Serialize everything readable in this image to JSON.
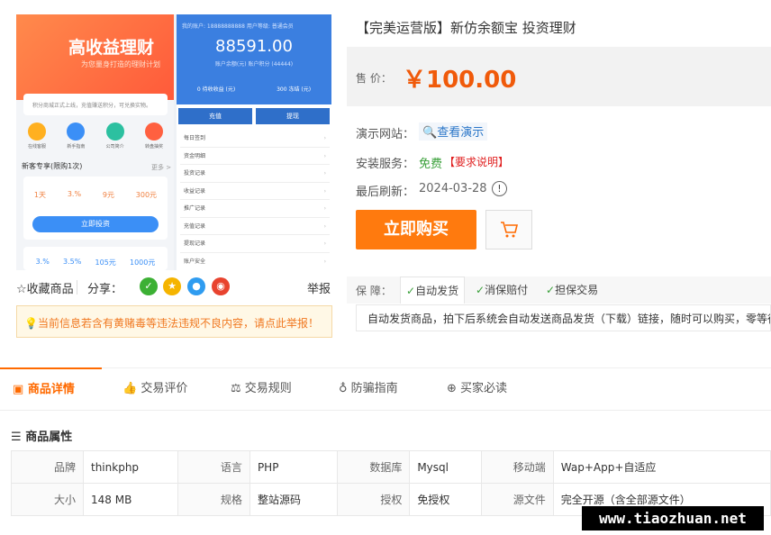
{
  "preview": {
    "banner_title": "高收益理财",
    "banner_sub": "为您量身打造的理财计划",
    "notice": "积分商城正式上线，充值赚送积分，可兑换实物。",
    "icons": [
      "在线客服",
      "新手指南",
      "公司简介",
      "转盘抽奖"
    ],
    "section": "新客专享(限购1次)",
    "more": "更多 >",
    "stats": [
      "1天",
      "3.%",
      "9元",
      "300元"
    ],
    "invest_btn": "立即投资",
    "stats2": [
      "3.%",
      "3.5%",
      "105元",
      "1000元"
    ],
    "blue_header": "我的账户: 18888888888    用户等级: 普通会员",
    "balance": "88591.00",
    "balance_sub": "账户余额(元)  账户积分 (44444)",
    "blue_row": [
      "0 待收收益 (元)",
      "300 冻结 (元)"
    ],
    "btn_recharge": "充值",
    "btn_withdraw": "提现",
    "menu": [
      "每日签到",
      "资金明细",
      "投资记录",
      "收益记录",
      "推广记录",
      "充值记录",
      "提现记录",
      "账户安全"
    ]
  },
  "share": {
    "fav": "☆收藏商品",
    "label": "分享：",
    "report": "举报"
  },
  "warning": "当前信息若含有黄赌毒等违法违规不良内容，请点此举报！",
  "product": {
    "title": "【完美运营版】新仿余额宝 投资理财",
    "price_label": "售 价：",
    "price": "￥100.00",
    "demo_label": "演示网站：",
    "demo_link": "查看演示",
    "install_label": "安装服务：",
    "install_value": "免费",
    "install_note": "【要求说明】",
    "refresh_label": "最后刷新：",
    "refresh_date": "2024-03-28",
    "buy_button": "立即购买",
    "guarantee_label": "保 障：",
    "guarantees": [
      "自动发货",
      "消保赔付",
      "担保交易"
    ],
    "guarantee_desc": "自动发货商品，拍下后系统会自动发送商品发货（下载）链接，随时可以购买，零等待"
  },
  "tabs": [
    "商品详情",
    "交易评价",
    "交易规则",
    "防骗指南",
    "买家必读"
  ],
  "attributes": {
    "title": "商品属性",
    "rows": [
      [
        [
          "品牌",
          "thinkphp"
        ],
        [
          "语言",
          "PHP"
        ],
        [
          "数据库",
          "Mysql"
        ],
        [
          "移动端",
          "Wap+App+自适应"
        ]
      ],
      [
        [
          "大小",
          "148 MB"
        ],
        [
          "规格",
          "整站源码"
        ],
        [
          "授权",
          "免授权"
        ],
        [
          "源文件",
          "完全开源（含全部源文件）"
        ]
      ]
    ]
  },
  "watermark": "www.tiaozhuan.net",
  "colors": {
    "accent": "#ff6a00",
    "price": "#f05a0a",
    "blue": "#3b7fe0"
  }
}
